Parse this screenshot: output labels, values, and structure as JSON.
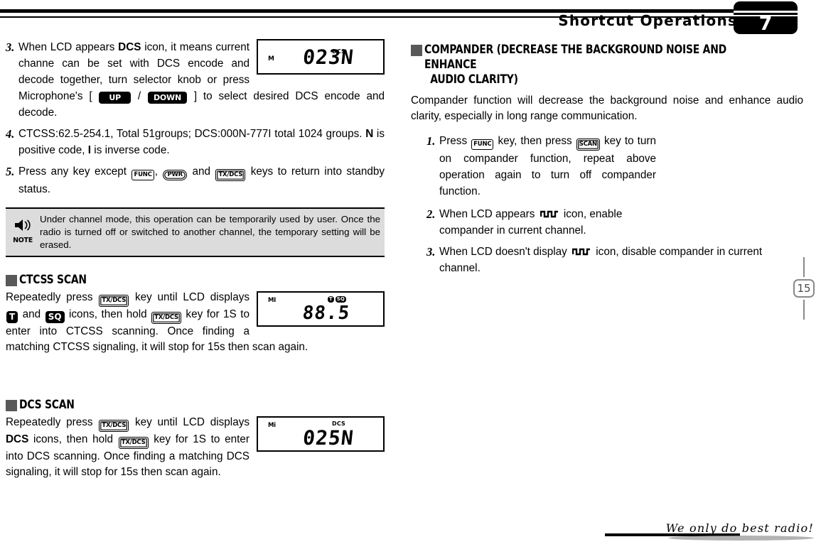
{
  "header": {
    "title": "Shortcut Operations",
    "chapter_number": "7"
  },
  "left_column": {
    "steps": [
      {
        "num": "3.",
        "text_a": "When LCD appears ",
        "bold_b": "DCS",
        "text_c": " icon, it means current channe can be set with DCS encode and decode together, turn selector knob or press Microphone's [ ",
        "key_up": "UP",
        "sep": " / ",
        "key_down": "DOWN",
        "text_d": " ] to select desired DCS encode and decode."
      },
      {
        "num": "4.",
        "text_a": "CTCSS:62.5-254.1, Total 51groups; DCS:000N-777I total 1024 groups. ",
        "bold_b": "N",
        "text_c": " is positive code, ",
        "bold_d": "I",
        "text_e": " is inverse code."
      },
      {
        "num": "5.",
        "text_a": "Press any key except ",
        "key_func": "FUNC",
        "text_b": ",  ",
        "key_pwr": "PWR",
        "text_c": " and ",
        "key_txdcs": "TX/DCS",
        "text_d": " keys to return into standby status."
      }
    ],
    "lcd_dcs_023": {
      "mode": "M",
      "tag": "DCS",
      "digits": "023N"
    },
    "note": {
      "icon_label": "NOTE",
      "text": "Under channel mode, this operation can be temporarily used by user. Once the radio is turned off or switched to another channel, the temporary setting will be erased."
    },
    "ctcss_scan": {
      "heading": "CTCSS SCAN",
      "text_a": "Repeatedly press ",
      "key_1": "TX/DCS",
      "text_b": " key until LCD displays ",
      "badge_t": "T",
      "text_c": " and ",
      "badge_sq": "SQ",
      "text_d": " icons, then hold ",
      "key_2": "TX/DCS",
      "text_e": " key for 1S to enter into CTCSS scanning. Once finding a matching CTCSS signaling, it will stop for 15s then scan again.",
      "lcd": {
        "mode": "MI",
        "icons": [
          "T",
          "SQ"
        ],
        "digits": "88.5"
      }
    },
    "dcs_scan": {
      "heading": "DCS SCAN",
      "text_a": "Repeatedly press ",
      "key_1": "TX/DCS",
      "text_b": " key until LCD displays ",
      "bold_dcs": "DCS",
      "text_c": " icons, then hold ",
      "key_2": "TX/DCS",
      "text_d": " key for 1S to enter into DCS scanning. Once finding a matching DCS signaling, it will stop for 15s then scan again.",
      "lcd": {
        "mode": "Mi",
        "tag": "DCS",
        "digits": "025N"
      }
    }
  },
  "right_column": {
    "heading_line1": "COMPANDER (DECREASE THE BACKGROUND NOISE AND ENHANCE",
    "heading_line2": "AUDIO CLARITY)",
    "intro": "Compander function will decrease the background noise and enhance audio clarity, especially in long range communication.",
    "steps": [
      {
        "num": "1.",
        "text_a": "Press ",
        "key_func": "FUNC",
        "text_b": " key, then press ",
        "key_scan": "SCAN",
        "text_c": " key to turn on compander function, repeat above operation again to turn off compander function."
      },
      {
        "num": "2.",
        "text_a": "When LCD appears ",
        "icon": "square-wave-icon",
        "text_b": " icon, enable compander in current channel."
      },
      {
        "num": "3.",
        "text_a": "When LCD doesn't display ",
        "icon": "square-wave-icon",
        "text_b": " icon, disable compander in current channel."
      }
    ]
  },
  "page_marker": {
    "page_number": "15"
  },
  "footer": {
    "slogan": "We only do best radio!"
  },
  "colors": {
    "ink": "#000000",
    "note_bg": "#dcdcdc",
    "heading_square": "#595959",
    "page_marker": "#8a8a8a"
  }
}
